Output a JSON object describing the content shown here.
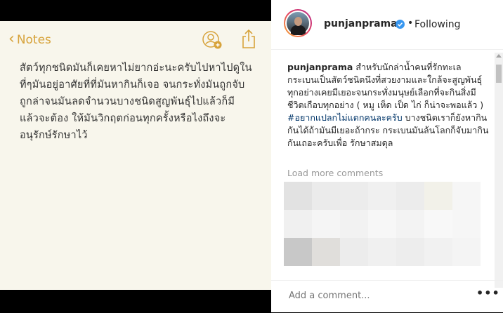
{
  "notes": {
    "back_label": "Notes",
    "body_lines": [
      "สัตว์ทุกชนิดมันก็เคยหาไม่ยากอ่ะนะครับไปหาไปดูใน",
      "ที่ๆมันอยู่อาศัยที่ที่มันหากินก็เจอ จนกระทั่งมันถูกจับ",
      "ถูกล่าจนมันลดจำนวนบางชนิดสูญพันธุ์ไปแล้วก็มี",
      "แล้วจะต้อง ให้มันวิกฤตก่อนทุกครั้งหรือไงถึงจะ",
      "อนุรักษ์รักษาไว้"
    ]
  },
  "post": {
    "username": "punjanprama",
    "separator": "•",
    "follow_status": "Following",
    "caption_user": "punjanprama",
    "caption_text": "สำหรับนักล่าน้ำคนที่รักทะเล กระเบนเป็นสัตว์ชนิดนึงที่สวยงามและใกล้จะสูญพันธุ์ ทุกอย่างเคยมีเยอะจนกระทั่งมนุษย์เลือกที่จะกินสิ่งมีชีวิตเกือบทุกอย่าง ( หมู เห็ด เป็ด ไก่ ก็น่าจะพอแล้ว ) ",
    "caption_hashtag": "#อยากแปลกไม่แดกคนละครับ",
    "caption_tail": " บางชนิดเราก็ยังหากินกันได้ถ้ามันมีเยอะถ้ากระ กระเบนมันล้นโลกก็จับมากินกันเถอะครับเพื่อ รักษาสมดุล",
    "load_more": "Load more comments",
    "comment_placeholder": "Add a comment...",
    "more_options": "•••"
  },
  "colors": {
    "notes_accent": "#d7a33b",
    "notes_bg": "#f8f6ec",
    "verified_blue": "#3897f0",
    "hashtag": "#003569"
  },
  "icons": [
    "chevron-left-icon",
    "add-person-icon",
    "share-icon",
    "verified-badge-icon",
    "more-icon"
  ]
}
